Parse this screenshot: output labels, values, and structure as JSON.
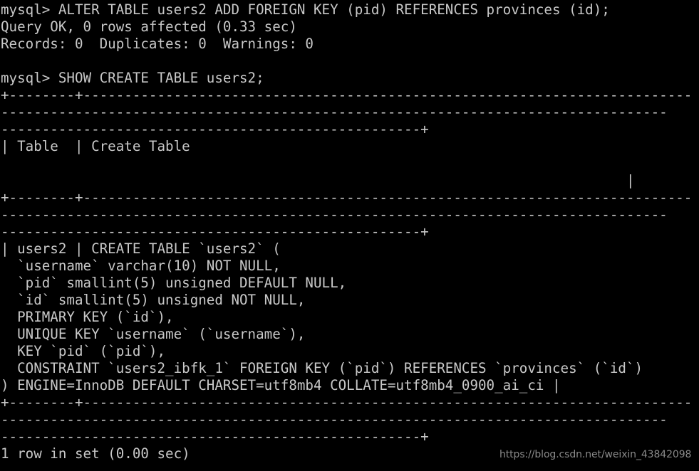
{
  "terminal": {
    "title": "mysql client session",
    "background_color": "#000000",
    "foreground_color": "#c8c8c8",
    "watermark_color": "#8a8a8a",
    "prompt": "mysql>",
    "lines": [
      "mysql> ALTER TABLE users2 ADD FOREIGN KEY (pid) REFERENCES provinces (id);",
      "Query OK, 0 rows affected (0.33 sec)",
      "Records: 0  Duplicates: 0  Warnings: 0",
      "",
      "mysql> SHOW CREATE TABLE users2;",
      "+--------+--------------------------------------------------------------------------",
      "---------------------------------------------------------------------------------",
      "---------------------------------------------------+",
      "| Table  | Create Table",
      "",
      "                                                                            |",
      "+--------+--------------------------------------------------------------------------",
      "---------------------------------------------------------------------------------",
      "---------------------------------------------------+",
      "| users2 | CREATE TABLE `users2` (",
      "  `username` varchar(10) NOT NULL,",
      "  `pid` smallint(5) unsigned DEFAULT NULL,",
      "  `id` smallint(5) unsigned NOT NULL,",
      "  PRIMARY KEY (`id`),",
      "  UNIQUE KEY `username` (`username`),",
      "  KEY `pid` (`pid`),",
      "  CONSTRAINT `users2_ibfk_1` FOREIGN KEY (`pid`) REFERENCES `provinces` (`id`)",
      ") ENGINE=InnoDB DEFAULT CHARSET=utf8mb4 COLLATE=utf8mb4_0900_ai_ci |",
      "+--------+--------------------------------------------------------------------------",
      "---------------------------------------------------------------------------------",
      "---------------------------------------------------+",
      "1 row in set (0.00 sec)"
    ]
  },
  "watermark": {
    "text": "https://blog.csdn.net/weixin_43842098"
  }
}
